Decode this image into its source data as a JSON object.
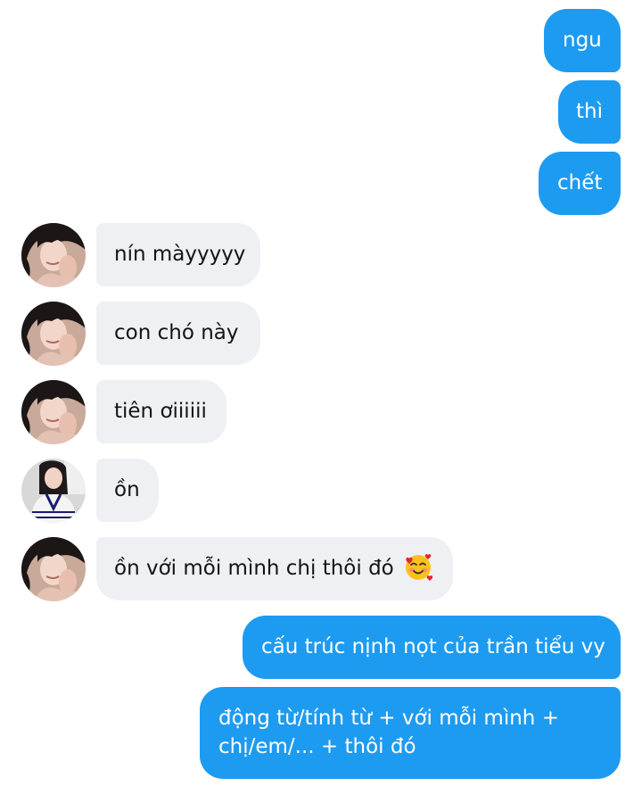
{
  "conversation": {
    "messages": [
      {
        "sender": "me",
        "text": "ngu"
      },
      {
        "sender": "me",
        "text": "thì"
      },
      {
        "sender": "me",
        "text": "chết"
      },
      {
        "sender": "other",
        "text": "nín màyyyyy",
        "avatar": "avatar-girl-dark-hair"
      },
      {
        "sender": "other",
        "text": "con chó này",
        "avatar": "avatar-girl-dark-hair"
      },
      {
        "sender": "other",
        "text": "tiên ơiiiiii",
        "avatar": "avatar-girl-dark-hair"
      },
      {
        "sender": "other",
        "text": "ồn",
        "avatar": "avatar-girl-sweater"
      },
      {
        "sender": "other",
        "text": "ồn với mỗi mình chị thôi đó",
        "avatar": "avatar-girl-dark-hair",
        "emoji": "smiling-face-with-hearts-icon"
      },
      {
        "sender": "me",
        "text": "cấu trúc nịnh nọt của trần tiểu vy"
      },
      {
        "sender": "me",
        "text_lines": [
          "động từ/tính từ + với mỗi mình +",
          "chị/em/... + thôi đó"
        ]
      }
    ]
  },
  "colors": {
    "outgoing_bubble": "#1d9bf0",
    "incoming_bubble": "#eef0f3",
    "outgoing_text": "#ffffff",
    "incoming_text": "#141414"
  }
}
